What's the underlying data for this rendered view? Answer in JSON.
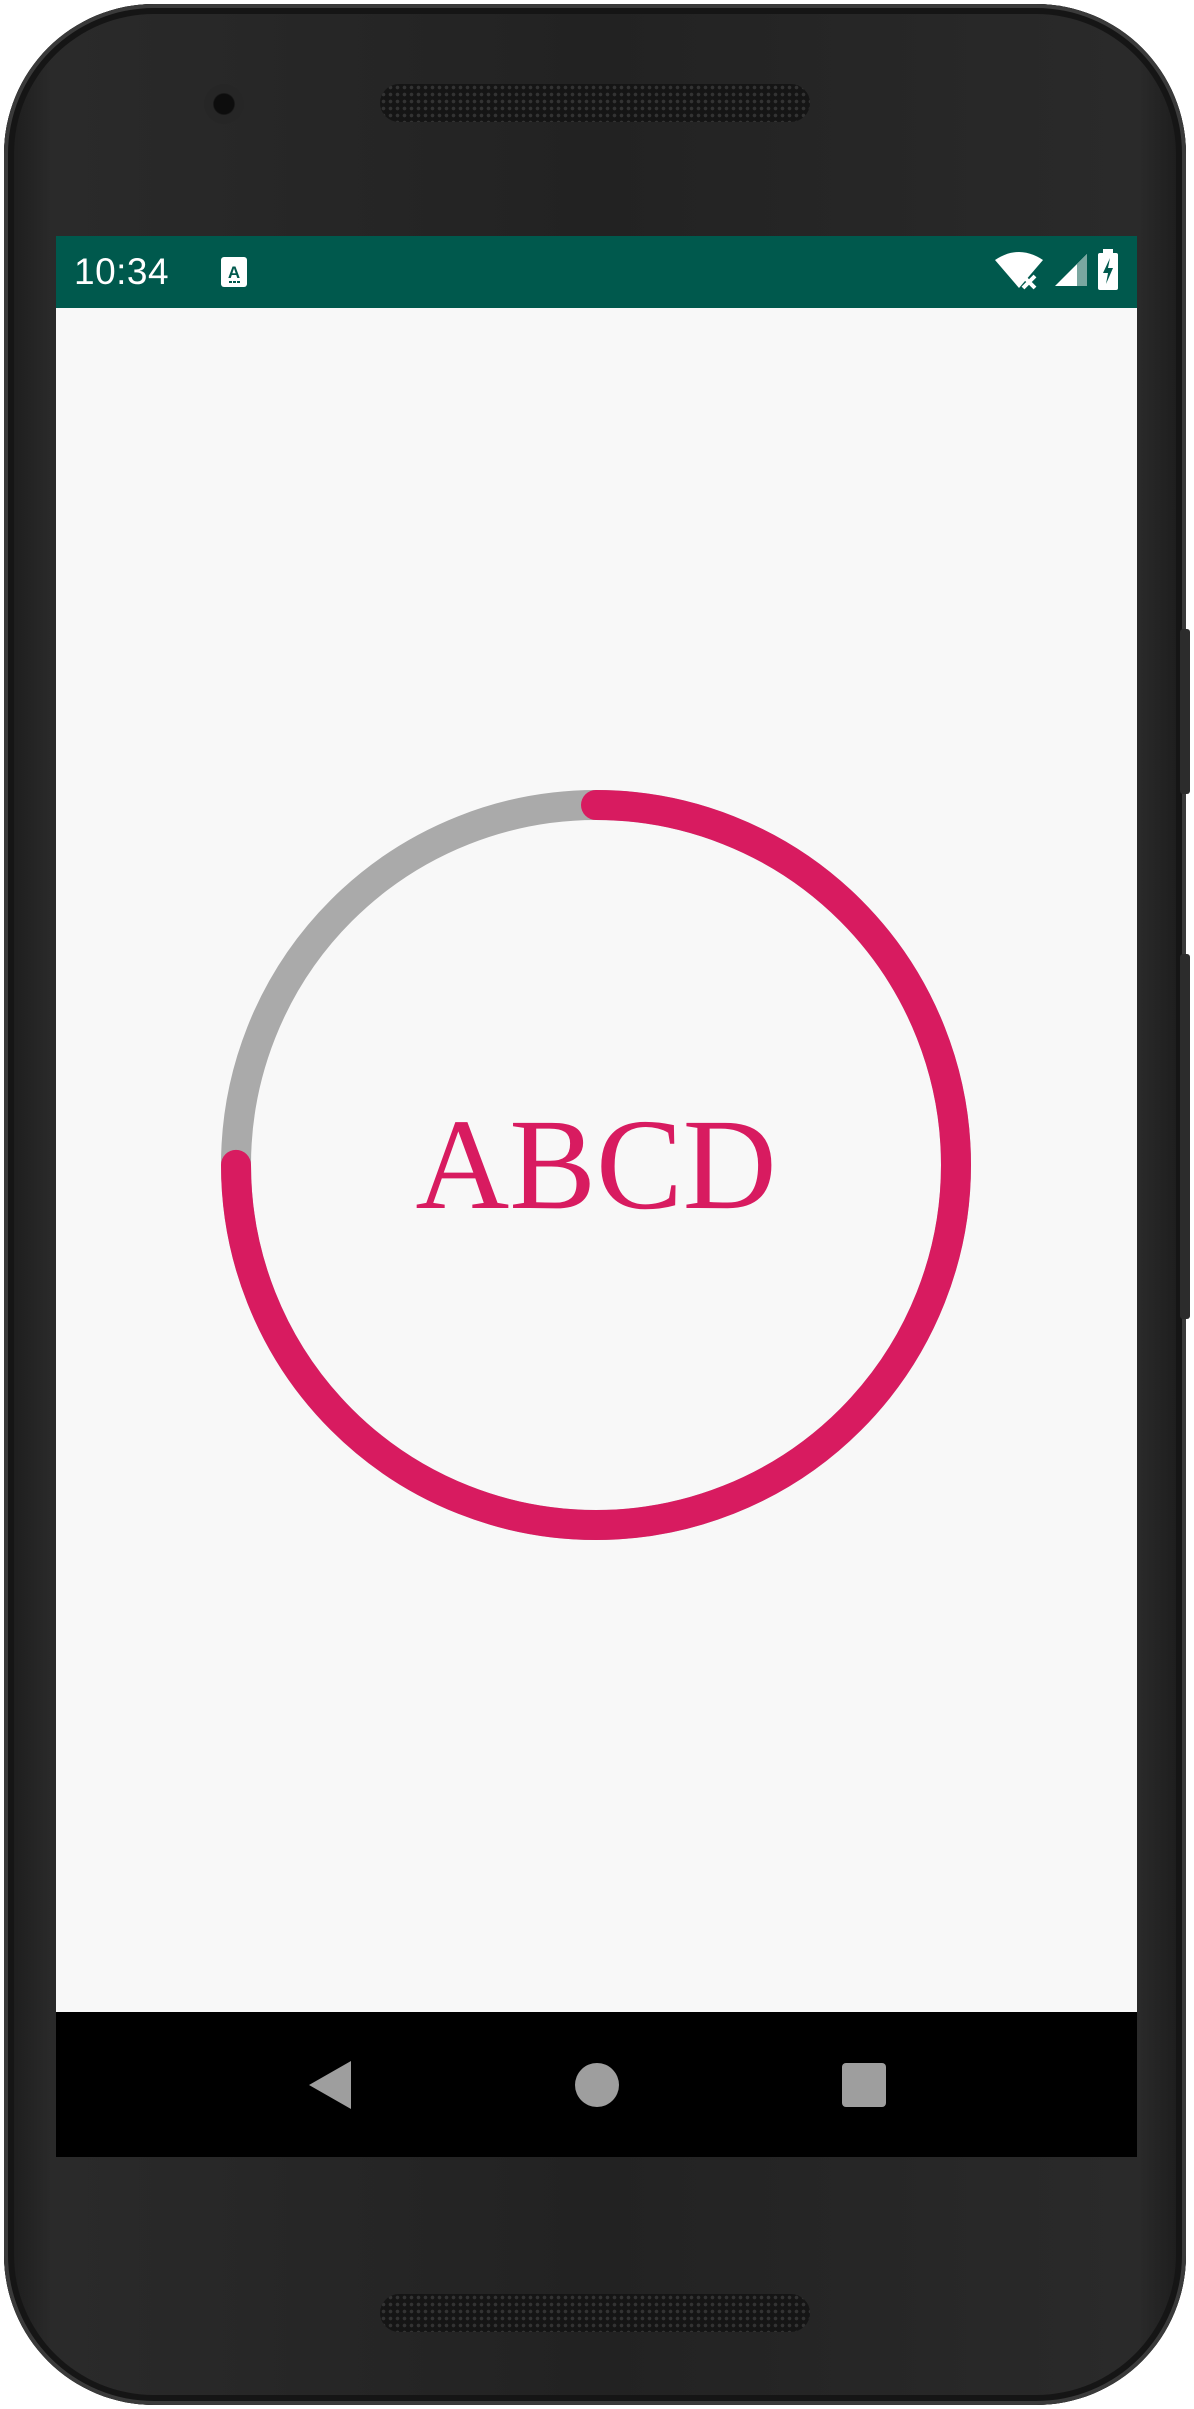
{
  "status_bar": {
    "time": "10:34",
    "notification_icon": "a-notification-icon",
    "icons": [
      "wifi-no-internet-icon",
      "cell-signal-icon",
      "battery-charging-icon"
    ],
    "background_color": "#00594d"
  },
  "progress": {
    "label": "ABCD",
    "value_percent": 75,
    "progress_color": "#d81b60",
    "track_color": "#aaaaaa"
  },
  "nav_bar": {
    "buttons": [
      "back-icon",
      "home-icon",
      "recents-icon"
    ]
  }
}
